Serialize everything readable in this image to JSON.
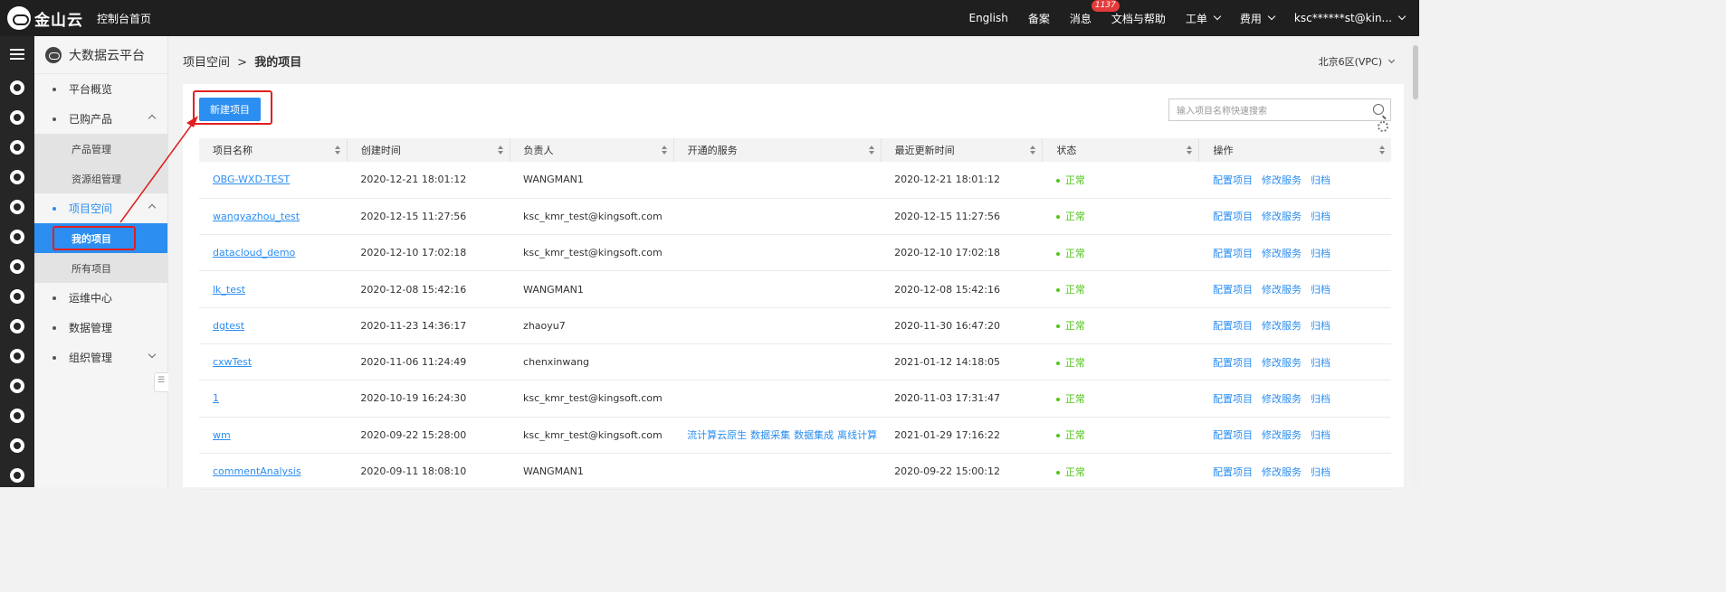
{
  "topbar": {
    "logo_text": "金山云",
    "console_home": "控制台首页",
    "english": "English",
    "record": "备案",
    "messages": "消息",
    "message_badge": "1137",
    "docs": "文档与帮助",
    "tickets": "工单",
    "billing": "费用",
    "account": "ksc******st@kin..."
  },
  "rail": {
    "icons": [
      "menu-icon",
      "layers-icon",
      "cloud-icon",
      "database-icon",
      "cluster-icon",
      "search-icon",
      "cube-icon",
      "storage-icon",
      "globe-icon",
      "network-icon",
      "bigdata-icon",
      "server-icon",
      "monitor-icon",
      "robot-icon",
      "share-icon"
    ]
  },
  "sidebar": {
    "title": "大数据云平台",
    "items": [
      {
        "label": "平台概览"
      },
      {
        "label": "已购产品",
        "sub": [
          "产品管理",
          "资源组管理"
        ]
      },
      {
        "label": "项目空间",
        "sub": [
          "我的项目",
          "所有项目"
        ]
      },
      {
        "label": "运维中心"
      },
      {
        "label": "数据管理"
      },
      {
        "label": "组织管理"
      }
    ]
  },
  "breadcrumb": {
    "parent": "项目空间",
    "separator": ">",
    "current": "我的项目"
  },
  "region": "北京6区(VPC)",
  "toolbar": {
    "new_project": "新建项目",
    "search_placeholder": "输入项目名称快速搜索"
  },
  "table": {
    "columns": [
      "项目名称",
      "创建时间",
      "负责人",
      "开通的服务",
      "最近更新时间",
      "状态",
      "操作"
    ],
    "actions": [
      "配置项目",
      "修改服务",
      "归档"
    ],
    "rows": [
      {
        "name": "OBG-WXD-TEST",
        "created": "2020-12-21 18:01:12",
        "owner": "WANGMAN1",
        "services": [],
        "updated": "2020-12-21 18:01:12",
        "status": "正常"
      },
      {
        "name": "wangyazhou_test",
        "created": "2020-12-15 11:27:56",
        "owner": "ksc_kmr_test@kingsoft.com",
        "services": [],
        "updated": "2020-12-15 11:27:56",
        "status": "正常"
      },
      {
        "name": "datacloud_demo",
        "created": "2020-12-10 17:02:18",
        "owner": "ksc_kmr_test@kingsoft.com",
        "services": [],
        "updated": "2020-12-10 17:02:18",
        "status": "正常"
      },
      {
        "name": "lk_test",
        "created": "2020-12-08 15:42:16",
        "owner": "WANGMAN1",
        "services": [],
        "updated": "2020-12-08 15:42:16",
        "status": "正常"
      },
      {
        "name": "dgtest",
        "created": "2020-11-23 14:36:17",
        "owner": "zhaoyu7",
        "services": [],
        "updated": "2020-11-30 16:47:20",
        "status": "正常"
      },
      {
        "name": "cxwTest",
        "created": "2020-11-06 11:24:49",
        "owner": "chenxinwang",
        "services": [],
        "updated": "2021-01-12 14:18:05",
        "status": "正常"
      },
      {
        "name": "1",
        "created": "2020-10-19 16:24:30",
        "owner": "ksc_kmr_test@kingsoft.com",
        "services": [],
        "updated": "2020-11-03 17:31:47",
        "status": "正常"
      },
      {
        "name": "wm",
        "created": "2020-09-22 15:28:00",
        "owner": "ksc_kmr_test@kingsoft.com",
        "services": [
          "流计算云原生",
          "数据采集",
          "数据集成",
          "离线计算"
        ],
        "updated": "2021-01-29 17:16:22",
        "status": "正常"
      },
      {
        "name": "commentAnalysis",
        "created": "2020-09-11 18:08:10",
        "owner": "WANGMAN1",
        "services": [],
        "updated": "2020-09-22 15:00:12",
        "status": "正常"
      }
    ]
  },
  "colors": {
    "accent": "#2b8ef0",
    "topbar": "#1f1f1f",
    "status_ok": "#52c41a",
    "annotation": "#e02020"
  }
}
